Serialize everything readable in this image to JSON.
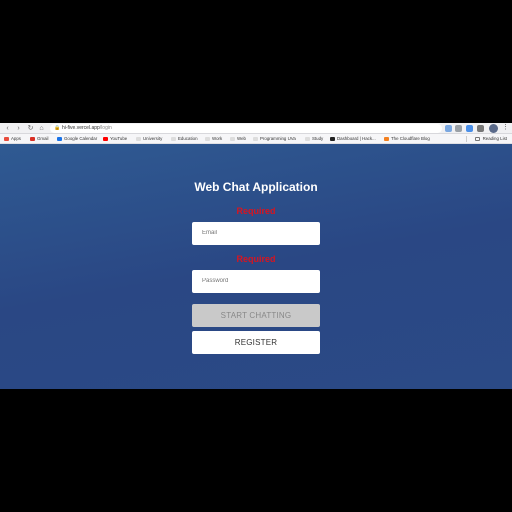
{
  "browser": {
    "url_host": "hi-five.vercel.app",
    "url_path": "/login",
    "bookmarks": [
      {
        "label": "Apps",
        "color": "#e84c3d"
      },
      {
        "label": "Gmail",
        "color": "#d93025"
      },
      {
        "label": "Google Calendar",
        "color": "#1a73e8"
      },
      {
        "label": "YouTube",
        "color": "#ff0000"
      },
      {
        "label": "University",
        "color": "#dddddd"
      },
      {
        "label": "Education",
        "color": "#dddddd"
      },
      {
        "label": "Work",
        "color": "#dddddd"
      },
      {
        "label": "Web",
        "color": "#dddddd"
      },
      {
        "label": "Programming UVa",
        "color": "#dddddd"
      },
      {
        "label": "Study",
        "color": "#dddddd"
      },
      {
        "label": "Dashboard | Hack...",
        "color": "#222222"
      },
      {
        "label": "The Cloudflare Blog",
        "color": "#f38020"
      }
    ],
    "reading_list": "Reading List"
  },
  "app": {
    "title": "Web Chat Application",
    "email_error": "Required",
    "email_placeholder": "Email",
    "password_error": "Required",
    "password_placeholder": "Password",
    "start_label": "START CHATTING",
    "register_label": "REGISTER"
  }
}
